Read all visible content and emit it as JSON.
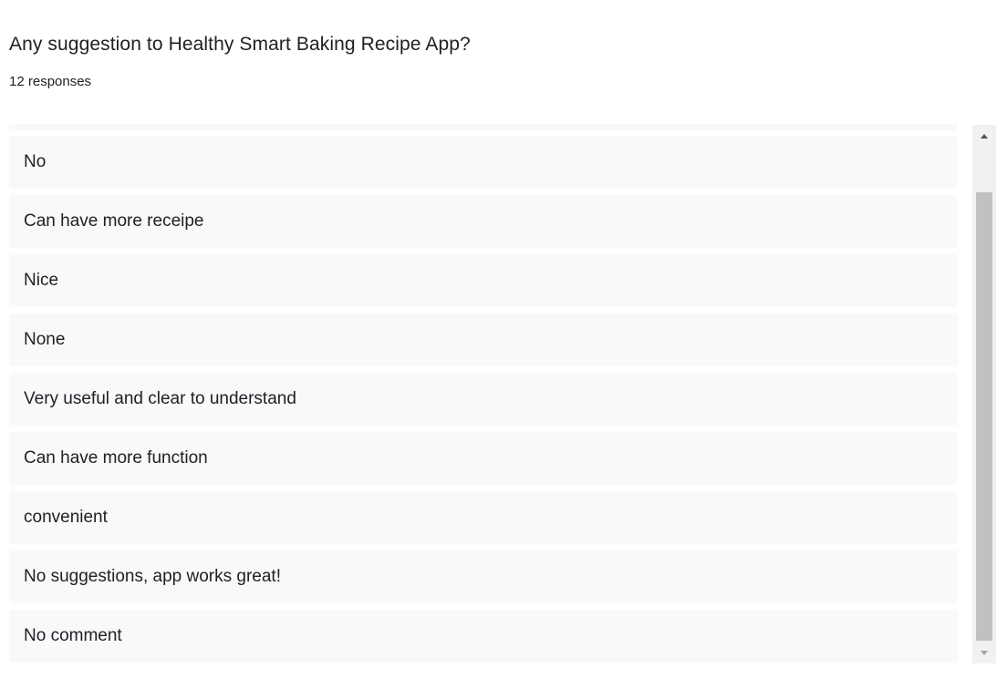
{
  "question": {
    "title": "Any suggestion to Healthy Smart Baking Recipe App?",
    "response_count": "12 responses"
  },
  "responses": [
    {
      "text": "No"
    },
    {
      "text": "Can have more receipe"
    },
    {
      "text": "Nice"
    },
    {
      "text": "None"
    },
    {
      "text": "Very useful and clear to understand"
    },
    {
      "text": "Can have more function"
    },
    {
      "text": "convenient"
    },
    {
      "text": "No suggestions, app works great!"
    },
    {
      "text": "No comment"
    }
  ],
  "scrollbar": {
    "up_icon": "triangle-up-icon",
    "down_icon": "triangle-down-icon"
  },
  "colors": {
    "item_background": "#f8f9fa",
    "text": "#202124",
    "scroll_thumb": "#c1c1c1",
    "scroll_track": "#f1f1f1"
  }
}
